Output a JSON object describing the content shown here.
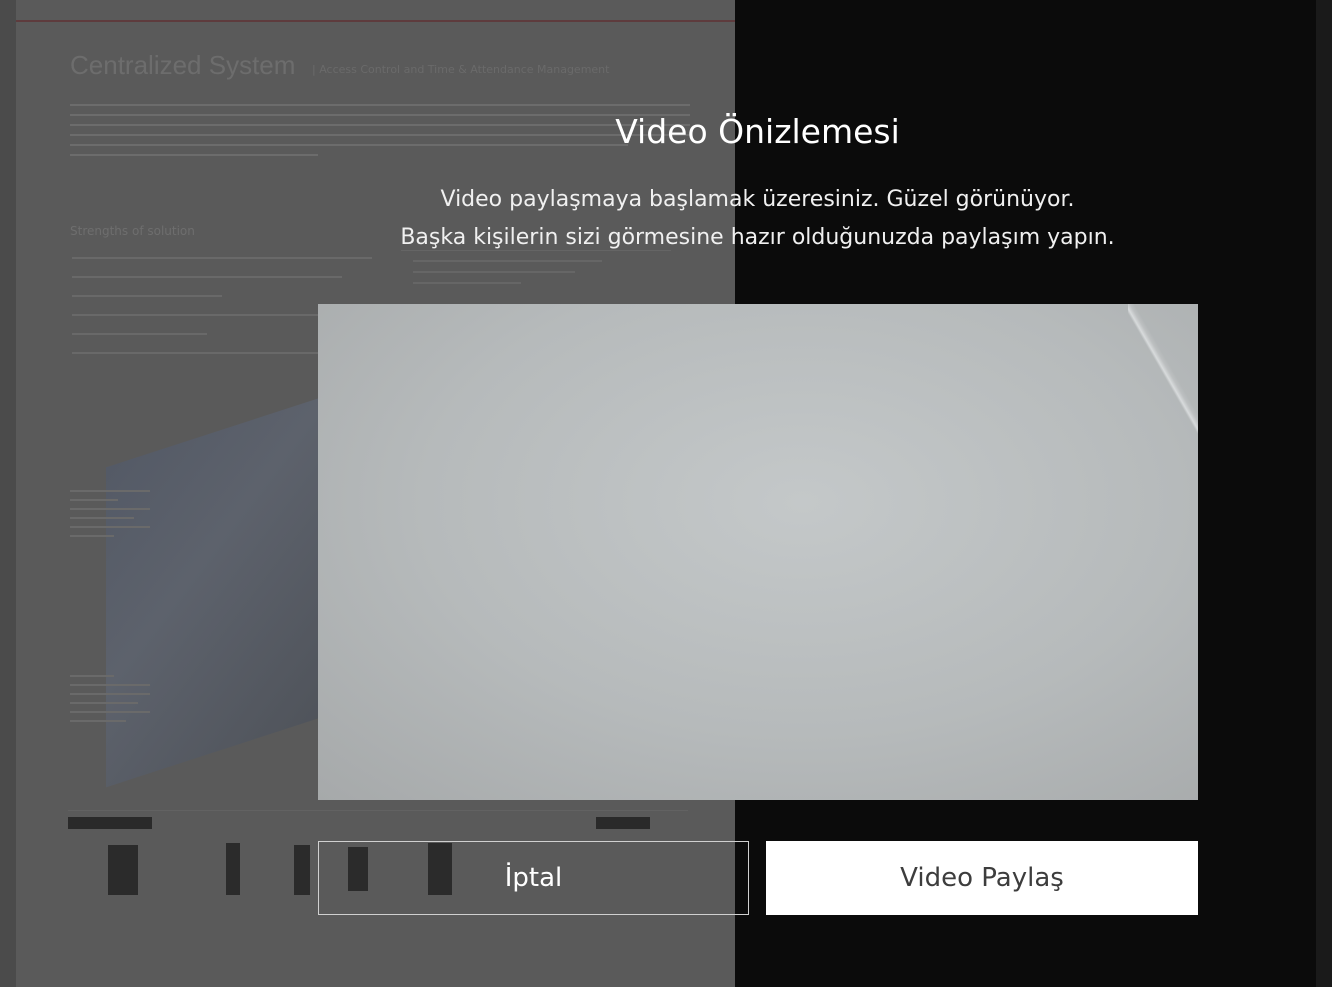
{
  "background_document": {
    "title": "Centralized System",
    "subtitle": "| Access Control and Time & Attendance Management",
    "section_heading": "Strengths of solution"
  },
  "modal": {
    "title": "Video Önizlemesi",
    "description_line1": "Video paylaşmaya başlamak üzeresiniz. Güzel görünüyor.",
    "description_line2": "Başka kişilerin sizi görmesine hazır olduğunuzda paylaşım yapın.",
    "cancel_label": "İptal",
    "share_label": "Video Paylaş"
  },
  "colors": {
    "overlay_background": "#0b0b0b",
    "share_button_bg": "#ffffff",
    "share_button_text": "#3d3d3d",
    "title_text": "#ffffff"
  }
}
